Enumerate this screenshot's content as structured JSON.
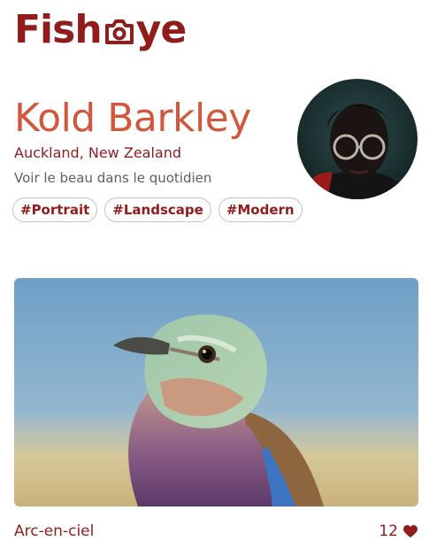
{
  "logo": {
    "part1": "Fish",
    "part2": "ye",
    "camera_icon": "camera-icon"
  },
  "profile": {
    "name": "Kold Barkley",
    "location": "Auckland, New Zealand",
    "tagline": "Voir le beau dans le quotidien",
    "tags": [
      "#Portrait",
      "#Landscape",
      "#Modern"
    ]
  },
  "media": {
    "title": "Arc-en-ciel",
    "likes": "12",
    "like_icon": "heart-icon"
  },
  "colors": {
    "brand": "#901C1C",
    "accent": "#D3573C",
    "muted": "#606060"
  }
}
